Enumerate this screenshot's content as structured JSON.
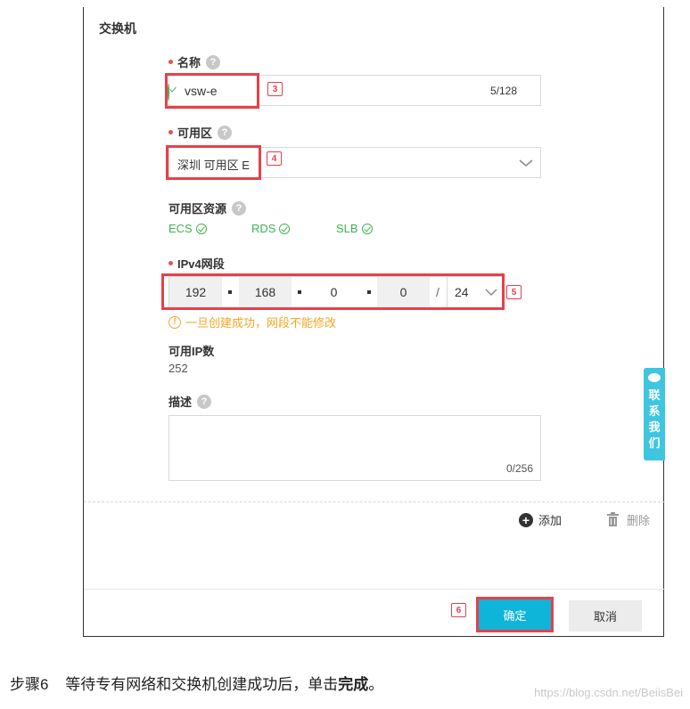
{
  "panel": {
    "section_title": "交换机",
    "name": {
      "label": "名称",
      "value": "vsw-e",
      "counter": "5/128",
      "badge": "3"
    },
    "zone": {
      "label": "可用区",
      "value": "深圳 可用区 E",
      "badge": "4"
    },
    "zone_resources": {
      "label": "可用区资源",
      "items": [
        "ECS",
        "RDS",
        "SLB"
      ]
    },
    "ipv4": {
      "label": "IPv4网段",
      "octets": [
        "192",
        "168",
        "0",
        "0"
      ],
      "slash": "/",
      "mask": "24",
      "badge": "5",
      "warning": "一旦创建成功，网段不能修改"
    },
    "available_ips": {
      "label": "可用IP数",
      "value": "252"
    },
    "description": {
      "label": "描述",
      "counter": "0/256"
    },
    "actions": {
      "add_label": "添加",
      "delete_label": "删除"
    },
    "footer": {
      "confirm_label": "确定",
      "cancel_label": "取消",
      "badge": "6"
    },
    "help_glyph": "?",
    "warning_glyph": "!"
  },
  "contact_tab": {
    "chars": [
      "联",
      "系",
      "我",
      "们"
    ]
  },
  "caption": {
    "step": "步骤6",
    "text": "等待专有网络和交换机创建成功后，单击",
    "bold": "完成",
    "end": "。"
  },
  "watermark": "https://blog.csdn.net/BeiisBei",
  "colors": {
    "accent": "#0fb5d8",
    "required": "#e8524f",
    "ok": "#3fb34f",
    "warning": "#f5a623",
    "annotation": "#e8404a"
  },
  "icons": {
    "name_valid": "check-circle-icon",
    "dropdown": "chevron-down-icon",
    "add": "plus-circle-icon",
    "delete": "trash-icon",
    "contact": "chat-bubble-icon",
    "warning": "exclamation-circle-icon"
  }
}
